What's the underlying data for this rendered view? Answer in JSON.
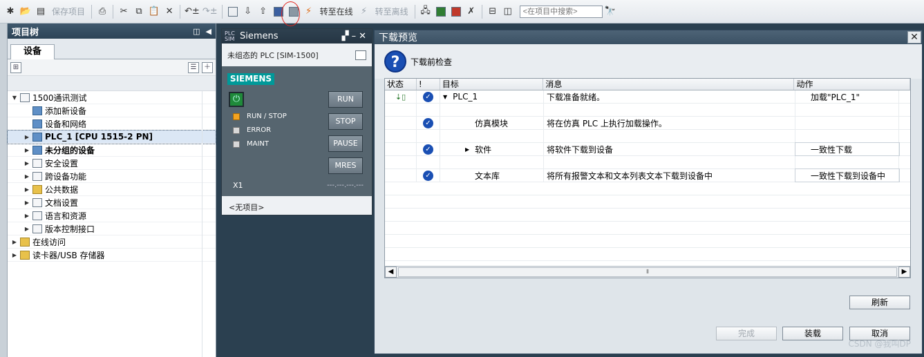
{
  "toolbar": {
    "save_project": "保存项目",
    "go_online": "转至在线",
    "go_offline": "转至离线",
    "search_placeholder": "<在项目中搜索>"
  },
  "tree": {
    "title": "项目树",
    "tab": "设备",
    "items": [
      {
        "label": "1500通讯测试",
        "level": 0,
        "arrow": "▼",
        "bold": false,
        "selected": false,
        "icon": "document-icon"
      },
      {
        "label": "添加新设备",
        "level": 1,
        "arrow": "",
        "bold": false,
        "selected": false,
        "icon": "add-device-icon"
      },
      {
        "label": "设备和网络",
        "level": 1,
        "arrow": "",
        "bold": false,
        "selected": false,
        "icon": "network-icon"
      },
      {
        "label": "PLC_1 [CPU 1515-2 PN]",
        "level": 1,
        "arrow": "▶",
        "bold": true,
        "selected": true,
        "icon": "plc-icon"
      },
      {
        "label": "未分组的设备",
        "level": 1,
        "arrow": "▶",
        "bold": true,
        "selected": false,
        "icon": "devices-icon"
      },
      {
        "label": "安全设置",
        "level": 1,
        "arrow": "▶",
        "bold": false,
        "selected": false,
        "icon": "security-icon"
      },
      {
        "label": "跨设备功能",
        "level": 1,
        "arrow": "▶",
        "bold": false,
        "selected": false,
        "icon": "cross-device-icon"
      },
      {
        "label": "公共数据",
        "level": 1,
        "arrow": "▶",
        "bold": false,
        "selected": false,
        "icon": "common-data-icon"
      },
      {
        "label": "文档设置",
        "level": 1,
        "arrow": "▶",
        "bold": false,
        "selected": false,
        "icon": "doc-settings-icon"
      },
      {
        "label": "语言和资源",
        "level": 1,
        "arrow": "▶",
        "bold": false,
        "selected": false,
        "icon": "language-icon"
      },
      {
        "label": "版本控制接口",
        "level": 1,
        "arrow": "▶",
        "bold": false,
        "selected": false,
        "icon": "version-control-icon"
      },
      {
        "label": "在线访问",
        "level": 0,
        "arrow": "▶",
        "bold": false,
        "selected": false,
        "icon": "online-access-icon"
      },
      {
        "label": "读卡器/USB 存储器",
        "level": 0,
        "arrow": "▶",
        "bold": false,
        "selected": false,
        "icon": "card-reader-icon"
      }
    ]
  },
  "sim": {
    "title": "Siemens",
    "logo_text": "PLC SIM",
    "subtitle": "未组态的 PLC [SIM-1500]",
    "brand": "SIEMENS",
    "leds": [
      "RUN / STOP",
      "ERROR",
      "MAINT"
    ],
    "buttons": [
      "RUN",
      "STOP",
      "PAUSE",
      "MRES"
    ],
    "x1": "X1",
    "dashes": "---.---.---.---",
    "footer": "<无项目>"
  },
  "dialog": {
    "title": "下载预览",
    "check_label": "下载前检查",
    "columns": [
      "状态",
      "!",
      "目标",
      "消息",
      "动作"
    ],
    "rows": [
      {
        "status": "download",
        "check": true,
        "target": "PLC_1",
        "expand": "▼",
        "indent": 0,
        "message": "下载准备就绪。",
        "action": "加载\"PLC_1\"",
        "action_box": false
      },
      {
        "status": "",
        "check": false,
        "target": "",
        "expand": "",
        "indent": 0,
        "message": "",
        "action": "",
        "action_box": false
      },
      {
        "status": "",
        "check": true,
        "target": "仿真模块",
        "expand": "",
        "indent": 1,
        "message": "将在仿真 PLC 上执行加载操作。",
        "action": "",
        "action_box": false
      },
      {
        "status": "",
        "check": false,
        "target": "",
        "expand": "",
        "indent": 0,
        "message": "",
        "action": "",
        "action_box": false
      },
      {
        "status": "",
        "check": true,
        "target": "软件",
        "expand": "▶",
        "indent": 1,
        "message": "将软件下载到设备",
        "action": "一致性下载",
        "action_box": true
      },
      {
        "status": "",
        "check": false,
        "target": "",
        "expand": "",
        "indent": 0,
        "message": "",
        "action": "",
        "action_box": false
      },
      {
        "status": "",
        "check": true,
        "target": "文本库",
        "expand": "",
        "indent": 1,
        "message": "将所有报警文本和文本列表文本下载到设备中",
        "action": "一致性下载到设备中",
        "action_box": true
      }
    ],
    "refresh": "刷新",
    "finish": "完成",
    "load": "装载",
    "cancel": "取消"
  },
  "watermark": "CSDN @我叫DP"
}
